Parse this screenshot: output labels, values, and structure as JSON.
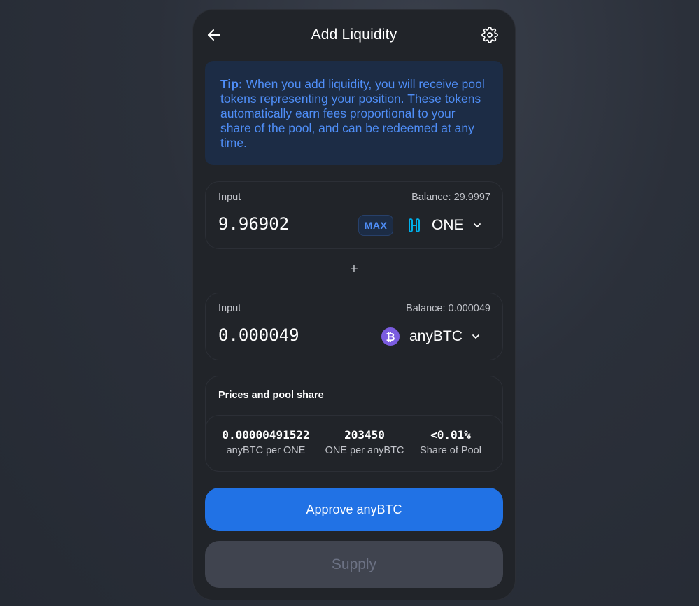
{
  "header": {
    "title": "Add Liquidity",
    "back_icon": "arrow-left-icon",
    "settings_icon": "gear-icon"
  },
  "tip": {
    "label": "Tip:",
    "text": "When you add liquidity, you will receive pool tokens representing your position. These tokens automatically earn fees proportional to your share of the pool, and can be redeemed at any time."
  },
  "input_a": {
    "label": "Input",
    "balance": "Balance: 29.9997",
    "amount": "9.96902",
    "max_label": "MAX",
    "token": "ONE",
    "token_icon": "harmony-one-logo-icon"
  },
  "plus_symbol": "+",
  "input_b": {
    "label": "Input",
    "balance": "Balance: 0.000049",
    "amount": "0.000049",
    "token": "anyBTC",
    "token_icon": "bitcoin-logo-icon"
  },
  "prices": {
    "title": "Prices and pool share",
    "stats": [
      {
        "value": "0.00000491522",
        "label": "anyBTC per ONE"
      },
      {
        "value": "203450",
        "label": "ONE per anyBTC"
      },
      {
        "value": "<0.01%",
        "label": "Share of Pool"
      }
    ]
  },
  "buttons": {
    "approve": "Approve anyBTC",
    "supply": "Supply"
  },
  "colors": {
    "accent_blue": "#2172e5",
    "tip_bg": "#1c2c45",
    "tip_text": "#4f8ef7",
    "card_bg": "#212429",
    "disabled_bg": "#40444f",
    "one_logo": "#00aee9",
    "btc_logo": "#7b5ce0"
  }
}
